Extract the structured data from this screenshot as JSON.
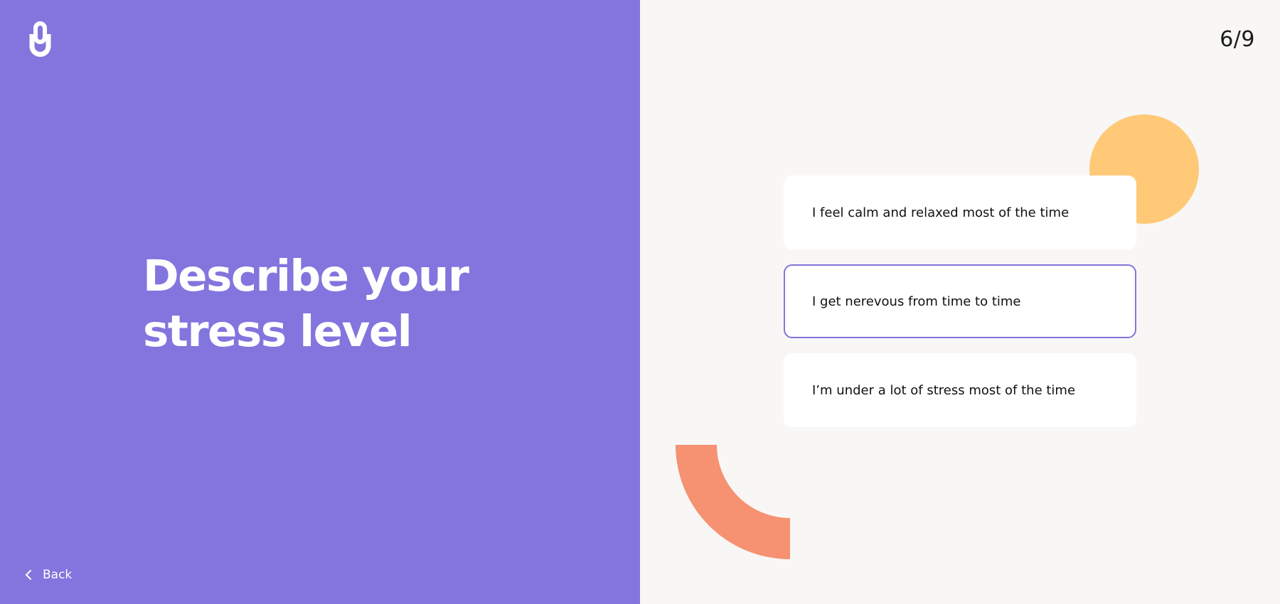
{
  "header": {
    "logo_icon": "brand-logo-icon",
    "progress": "6/9"
  },
  "question": {
    "title_line1": "Describe your",
    "title_line2": "stress level"
  },
  "options": [
    {
      "label": "I feel calm and relaxed most of the time",
      "selected": false
    },
    {
      "label": "I get nerevous from time to time",
      "selected": true
    },
    {
      "label": "I’m under a lot of stress most of the time",
      "selected": false
    }
  ],
  "footer": {
    "back_label": "Back",
    "back_icon": "chevron-left-icon"
  },
  "colors": {
    "primary_purple": "#8275de",
    "background_light": "#f8f7f5",
    "accent_yellow": "#ffc978",
    "accent_coral": "#f69272",
    "card_white": "#ffffff"
  }
}
